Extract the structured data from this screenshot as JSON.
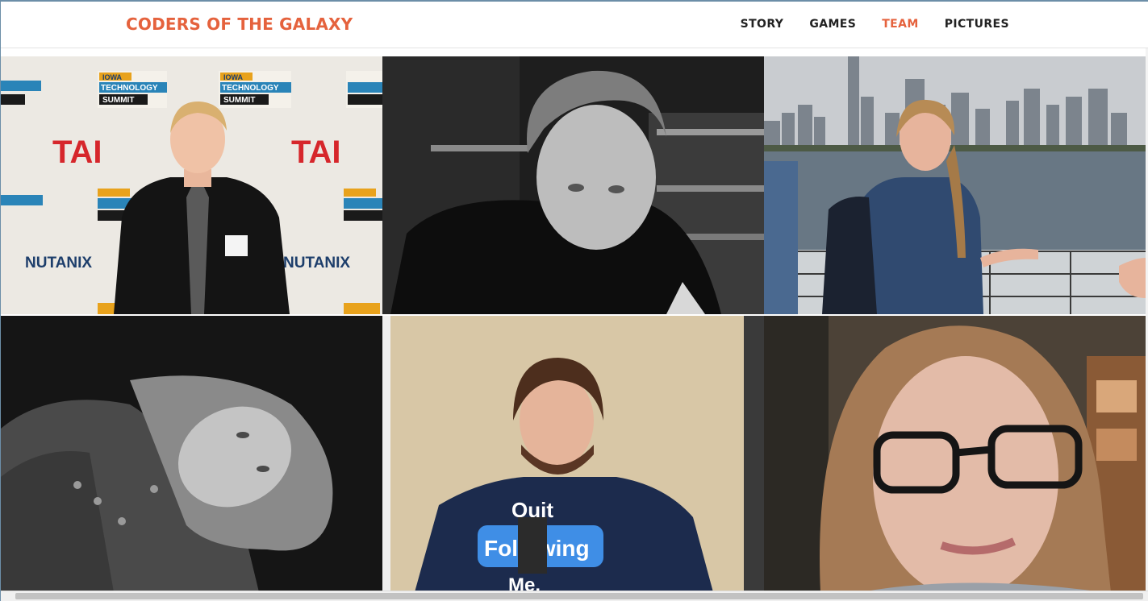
{
  "header": {
    "brand": "CODERS OF THE GALAXY",
    "nav": [
      {
        "label": "STORY",
        "active": false
      },
      {
        "label": "GAMES",
        "active": false
      },
      {
        "label": "TEAM",
        "active": true
      },
      {
        "label": "PICTURES",
        "active": false
      }
    ]
  },
  "photos": {
    "p1": {
      "banner_iowa": "IOWA",
      "banner_tech": "TECHNOLOGY",
      "banner_summit": "SUMMIT",
      "tai": "TAI",
      "nutanix": "NUTANIX"
    },
    "p5": {
      "shirt_line1": "Quit",
      "shirt_line2": "Following",
      "shirt_line3": "Me."
    }
  },
  "colors": {
    "accent": "#e5623d",
    "nav_text": "#222222"
  }
}
